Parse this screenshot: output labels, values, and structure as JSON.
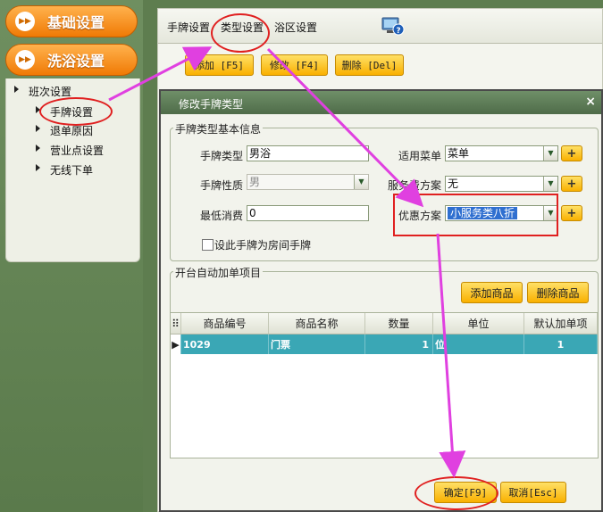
{
  "sidebar": {
    "btn_basic": "基础设置",
    "btn_bath": "洗浴设置",
    "items": [
      {
        "label": "班次设置"
      },
      {
        "label": "手牌设置"
      },
      {
        "label": "退单原因"
      },
      {
        "label": "营业点设置"
      },
      {
        "label": "无线下单"
      }
    ]
  },
  "tabs": [
    {
      "label": "手牌设置"
    },
    {
      "label": "类型设置"
    },
    {
      "label": "浴区设置"
    }
  ],
  "toolbar": {
    "add": "添加 [F5]",
    "edit": "修改 [F4]",
    "delete": "删除 [Del]"
  },
  "dialog": {
    "title": "修改手牌类型",
    "close": "×",
    "group_basic": "手牌类型基本信息",
    "fields": {
      "type_label": "手牌类型",
      "type_value": "男浴",
      "nature_label": "手牌性质",
      "nature_value": "男",
      "minspend_label": "最低消费",
      "minspend_value": "0",
      "menu_label": "适用菜单",
      "menu_value": "菜单",
      "service_label": "服务费方案",
      "service_value": "无",
      "discount_label": "优惠方案",
      "discount_value": "小服务类八折",
      "room_checkbox": "设此手牌为房间手牌"
    },
    "group_auto": "开台自动加单项目",
    "btn_add_goods": "添加商品",
    "btn_del_goods": "删除商品",
    "table": {
      "columns": [
        "商品编号",
        "商品名称",
        "数量",
        "单位",
        "默认加单项"
      ],
      "rows": [
        {
          "code": "1029",
          "name": "门票",
          "qty": "1",
          "unit": "位",
          "default": "1"
        }
      ]
    },
    "ok": "确定[F9]",
    "cancel": "取消[Esc]"
  },
  "colors": {
    "accent_orange": "#f07a05",
    "button_yellow": "#f9b000",
    "title_green": "#4f6c49",
    "row_selected": "#3aa7b5",
    "annotation_magenta": "#e040e0",
    "annotation_red": "#e02020"
  },
  "icons": {
    "help": "computer-help-icon",
    "plus": "plus-icon",
    "row_pointer": "row-pointer-icon"
  }
}
